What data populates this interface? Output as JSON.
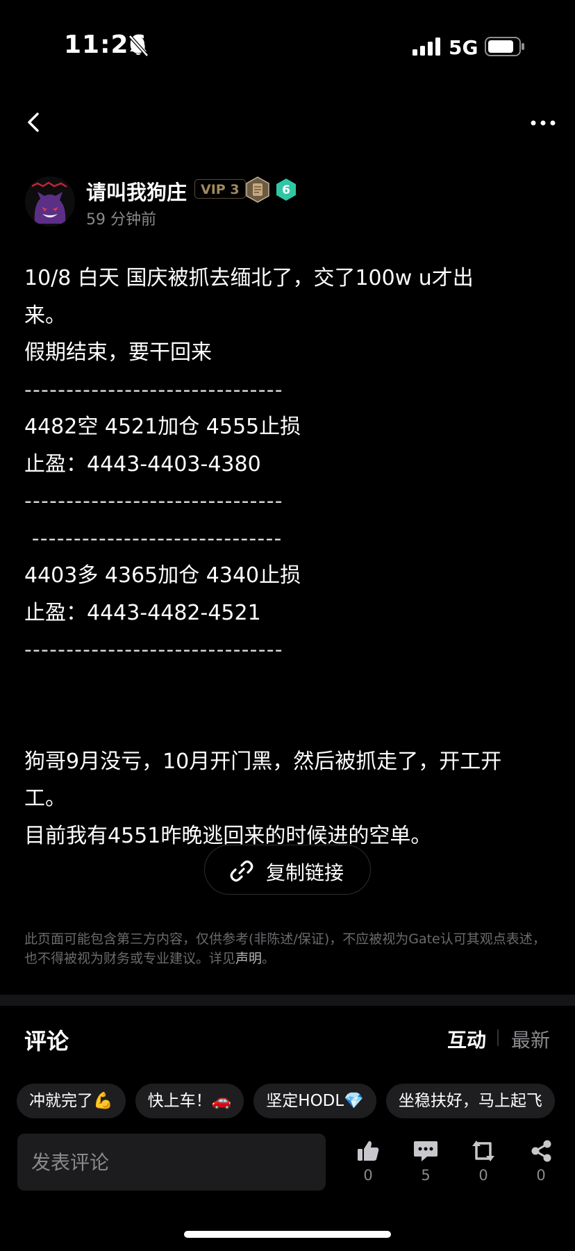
{
  "status_bar": {
    "time": "11:26",
    "network": "5G"
  },
  "author": {
    "name": "请叫我狗庄",
    "vip": "VIP 3",
    "level": "6",
    "time_ago": "59 分钟前"
  },
  "post": {
    "lines": [
      "10/8  白天  国庆被抓去缅北了，交了100w u才出",
      "来。",
      "假期结束，要干回来",
      "-------------------------------",
      "4482空 4521加仓 4555止损",
      "止盈：4443-4403-4380",
      "-------------------------------",
      " ------------------------------",
      "4403多  4365加仓 4340止损",
      "止盈：4443-4482-4521",
      "-------------------------------",
      "",
      "狗哥9月没亏，10月开门黑，然后被抓走了，开工开",
      "工。",
      "目前我有4551昨晚逃回来的时候进的空单。"
    ]
  },
  "copy_link_label": "复制链接",
  "disclaimer": {
    "text": "此页面可能包含第三方内容，仅供参考(非陈述/保证)，不应被视为Gate认可其观点表述，也不得被视为财务或专业建议。详见",
    "link": "声明",
    "end": "。"
  },
  "comments": {
    "title": "评论",
    "tab_interact": "互动",
    "tab_latest": "最新",
    "quick_replies": [
      "冲就完了💪",
      "快上车！🚗",
      "坚定HODL💎",
      "坐稳扶好，马上起飞"
    ],
    "input_placeholder": "发表评论"
  },
  "actions": {
    "likes": "0",
    "comments": "5",
    "reposts": "0",
    "shares": "0"
  },
  "colors": {
    "background": "#000000",
    "vip_gold": "#9f8a5e",
    "level_badge": "#2fc7a4"
  }
}
